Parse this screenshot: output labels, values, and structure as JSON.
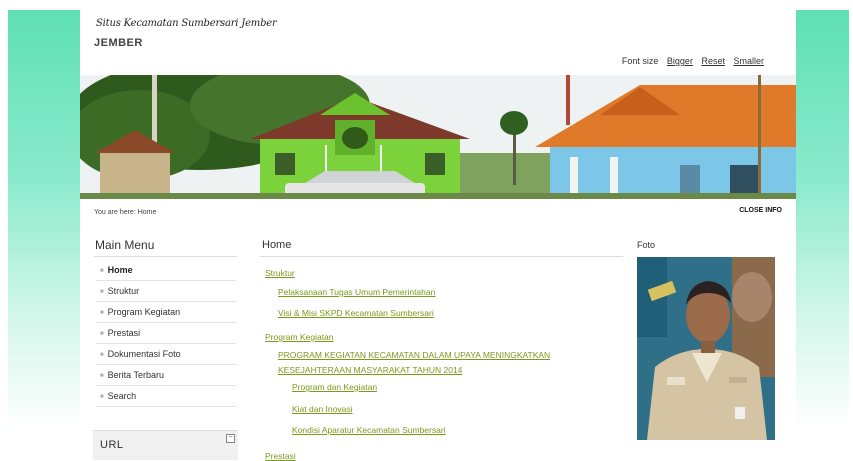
{
  "site": {
    "title": "Situs Kecamatan Sumbersari Jember",
    "subtitle": "JEMBER"
  },
  "font_controls": {
    "label": "Font size",
    "bigger": "Bigger",
    "reset": "Reset",
    "smaller": "Smaller"
  },
  "breadcrumb": "You are here: Home",
  "close_info": "CLOSE INFO",
  "main_menu": {
    "title": "Main Menu",
    "items": [
      {
        "label": "Home",
        "active": true
      },
      {
        "label": "Struktur"
      },
      {
        "label": "Program Kegiatan"
      },
      {
        "label": "Prestasi"
      },
      {
        "label": "Dokumentasi Foto"
      },
      {
        "label": "Berita Terbaru"
      },
      {
        "label": "Search"
      }
    ]
  },
  "url_box": {
    "title": "URL",
    "toggle": "−"
  },
  "content": {
    "title": "Home",
    "links": [
      "Struktur",
      "Pelaksanaan Tugas Umum Pemerintahan",
      "Visi & Misi SKPD Kecamatan Sumbersari",
      "Program Kegiatan",
      "PROGRAM KEGIATAN KECAMATAN DALAM UPAYA MENINGKATKAN",
      "KESEJAHTERAAN MASYARAKAT TAHUN 2014",
      "Program dan Kegiatan",
      "Kiat dan Inovasi",
      "Kondisi Aparatur Kecamatan Sumbersari",
      "Prestasi"
    ]
  },
  "foto": {
    "title": "Foto"
  },
  "colors": {
    "link": "#7a9a1a",
    "side_gradient": "#5fe0b4"
  }
}
